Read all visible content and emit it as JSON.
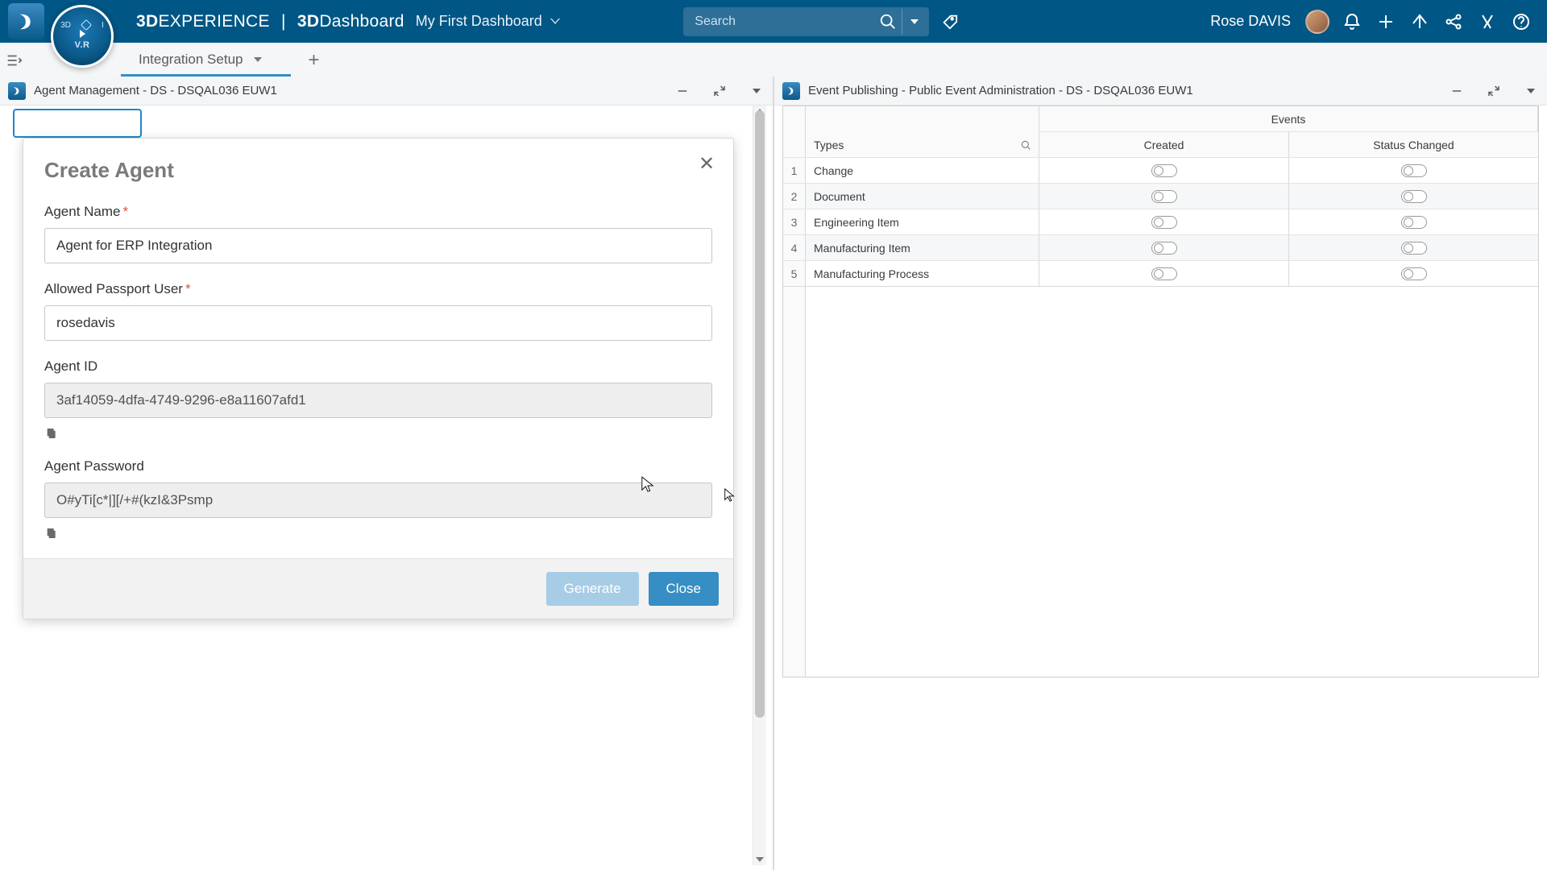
{
  "header": {
    "brand_bold1": "3D",
    "brand_light1": "EXPERIENCE",
    "brand_bold2": "3D",
    "brand_light2": "Dashboard",
    "dashboard_name": "My First Dashboard",
    "search_placeholder": "Search",
    "user_name": "Rose DAVIS"
  },
  "compass": {
    "tl": "3D",
    "tr": "I",
    "bottom": "V.R"
  },
  "tabs": {
    "active": "Integration Setup"
  },
  "leftPanel": {
    "title": "Agent Management - DS - DSQAL036 EUW1"
  },
  "dialog": {
    "title": "Create Agent",
    "labels": {
      "agent_name": "Agent Name",
      "passport_user": "Allowed Passport User",
      "agent_id": "Agent ID",
      "agent_password": "Agent Password"
    },
    "values": {
      "agent_name": "Agent for ERP Integration",
      "passport_user": "rosedavis",
      "agent_id": "3af14059-4dfa-4749-9296-e8a11607afd1",
      "agent_password": "O#yTi[c*|][/+#(kzI&3Psmp"
    },
    "buttons": {
      "generate": "Generate",
      "close": "Close"
    }
  },
  "rightPanel": {
    "title": "Event Publishing - Public Event Administration - DS - DSQAL036 EUW1",
    "columns": {
      "types": "Types",
      "events": "Events",
      "created": "Created",
      "status_changed": "Status Changed"
    },
    "rows": [
      {
        "n": "1",
        "type": "Change"
      },
      {
        "n": "2",
        "type": "Document"
      },
      {
        "n": "3",
        "type": "Engineering Item"
      },
      {
        "n": "4",
        "type": "Manufacturing Item"
      },
      {
        "n": "5",
        "type": "Manufacturing Process"
      }
    ]
  }
}
